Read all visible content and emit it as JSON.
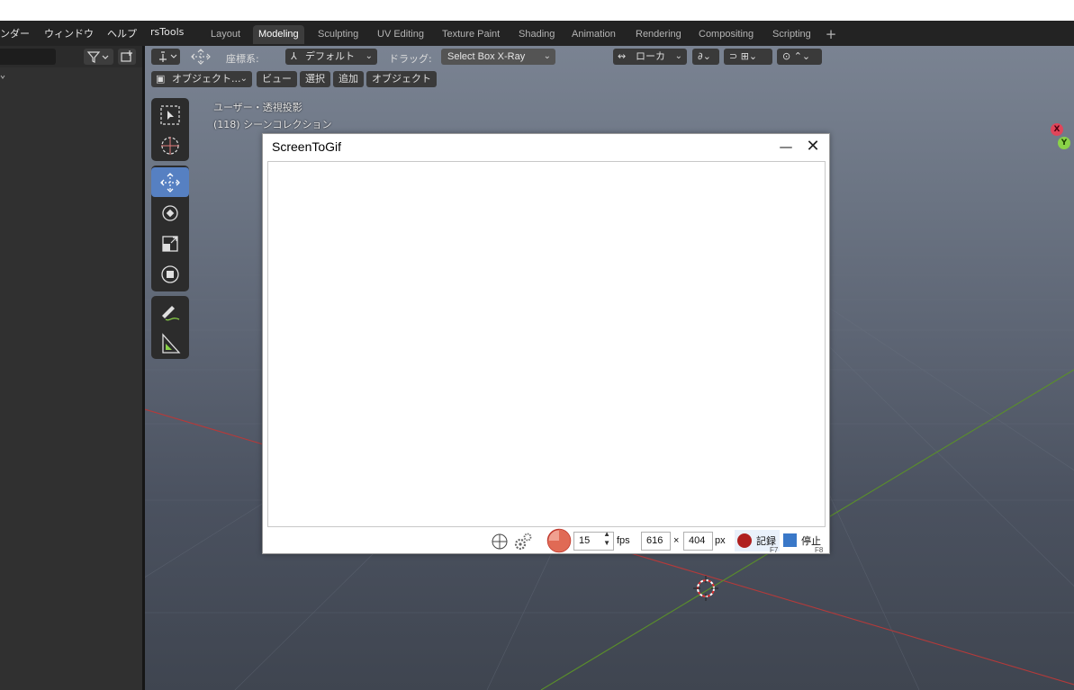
{
  "menu": {
    "items": [
      "ンダー",
      "ウィンドウ",
      "ヘルプ",
      "rsTools"
    ]
  },
  "workspace_tabs": [
    {
      "label": "Layout",
      "active": false
    },
    {
      "label": "Modeling",
      "active": true
    },
    {
      "label": "Sculpting",
      "active": false
    },
    {
      "label": "UV Editing",
      "active": false
    },
    {
      "label": "Texture Paint",
      "active": false
    },
    {
      "label": "Shading",
      "active": false
    },
    {
      "label": "Animation",
      "active": false
    },
    {
      "label": "Rendering",
      "active": false
    },
    {
      "label": "Compositing",
      "active": false
    },
    {
      "label": "Scripting",
      "active": false
    }
  ],
  "add_tab_label": "+",
  "viewport_header": {
    "coord_label": "座標系:",
    "coord_value": "デフォルト",
    "drag_label": "ドラッグ:",
    "drag_value": "Select Box X-Ray",
    "pivot_value": "ローカ"
  },
  "viewport_menu": {
    "mode": "オブジェクト...",
    "view": "ビュー",
    "select": "選択",
    "add": "追加",
    "object": "オブジェクト"
  },
  "viewport_info": {
    "perspective": "ユーザー・透視投影",
    "collection": "(118) シーンコレクション"
  },
  "gizmo": {
    "x": "X",
    "y": "Y"
  },
  "screentogif": {
    "title": "ScreenToGif",
    "minimize_glyph": "—",
    "close_glyph": "✕",
    "fps_value": "15",
    "fps_label": "fps",
    "width_value": "616",
    "times_label": "×",
    "height_value": "404",
    "px_label": "px",
    "record_label": "記録",
    "record_key": "F7",
    "stop_label": "停止",
    "stop_key": "F8"
  },
  "colors": {
    "accent_active_tool": "#5680c2",
    "record_red": "#c0282c",
    "stop_blue": "#3a78c8",
    "x_axis": "#b53a3a",
    "y_axis": "#5a8f2a"
  }
}
